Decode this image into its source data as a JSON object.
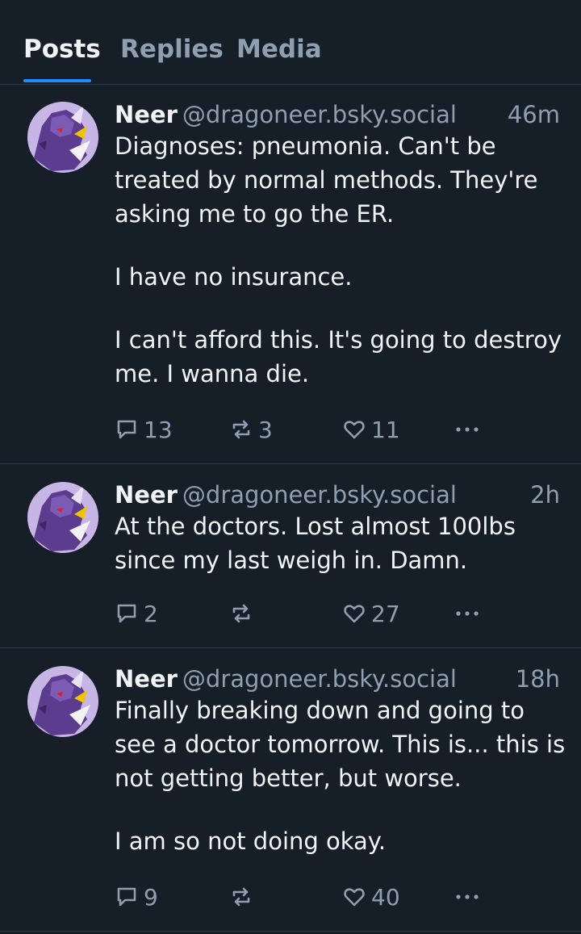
{
  "tabs": [
    {
      "label": "Posts",
      "active": true
    },
    {
      "label": "Replies",
      "active": false
    },
    {
      "label": "Media",
      "active": false
    }
  ],
  "accent_color": "#208bfe",
  "posts": [
    {
      "author_name": "Neer",
      "author_handle": "@dragoneer.bsky.social",
      "time": "46m",
      "paragraphs": [
        "Diagnoses: pneumonia. Can't be treated by normal methods. They're asking me to go the ER.",
        "I have no insurance.",
        "I can't afford this. It's going to destroy me. I wanna die."
      ],
      "replies": "13",
      "reposts": "3",
      "likes": "11"
    },
    {
      "author_name": "Neer",
      "author_handle": "@dragoneer.bsky.social",
      "time": "2h",
      "paragraphs": [
        "At the doctors. Lost almost 100lbs since my last weigh in. Damn."
      ],
      "replies": "2",
      "reposts": "",
      "likes": "27"
    },
    {
      "author_name": "Neer",
      "author_handle": "@dragoneer.bsky.social",
      "time": "18h",
      "paragraphs": [
        "Finally breaking down and going to see a doctor tomorrow. This is... this is not getting better, but worse.",
        "I am so not doing okay."
      ],
      "replies": "9",
      "reposts": "",
      "likes": "40"
    }
  ],
  "icons": {
    "reply": "reply-bubble-icon",
    "repost": "repost-arrows-icon",
    "like": "heart-icon",
    "more": "more-dots-icon",
    "avatar": "purple-dragon-avatar"
  }
}
